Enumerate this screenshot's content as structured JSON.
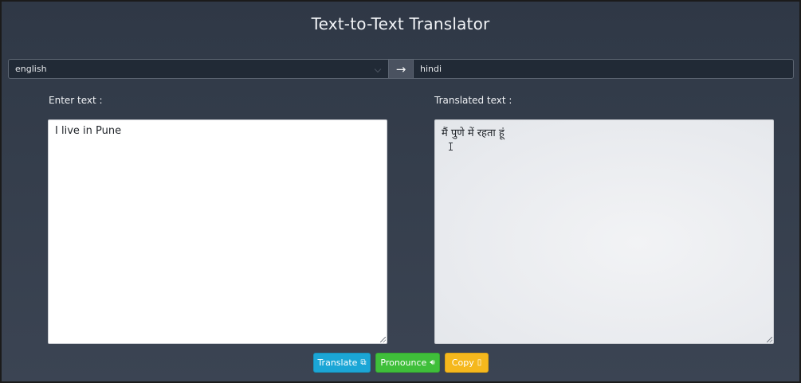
{
  "app": {
    "title": "Text-to-Text Translator"
  },
  "languages": {
    "from": "english",
    "to": "hindi"
  },
  "input": {
    "label": "Enter text :",
    "value": "I live in Pune"
  },
  "output": {
    "label": "Translated text :",
    "value": "मैं पुणे में रहता हूं"
  },
  "buttons": {
    "translate": "Translate",
    "pronounce": "Pronounce",
    "copy": "Copy"
  },
  "icons": {
    "swap": "arrow-right-icon",
    "translate": "translate-icon",
    "pronounce": "speaker-icon",
    "copy": "clipboard-icon"
  },
  "colors": {
    "translate": "#1ba6d6",
    "pronounce": "#3fbf3a",
    "copy": "#f5b81d"
  }
}
